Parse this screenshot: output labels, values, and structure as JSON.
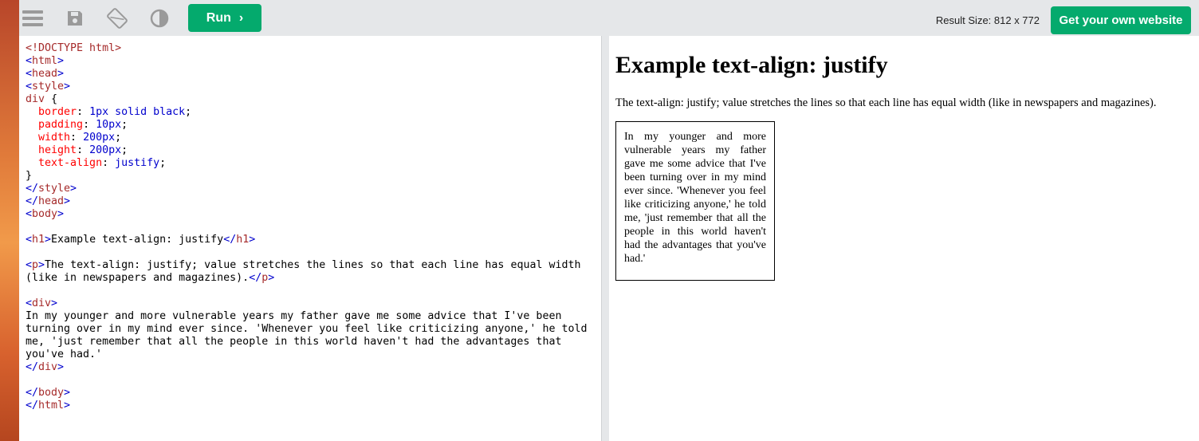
{
  "toolbar": {
    "menu_icon": "menu-icon",
    "save_icon": "save-icon",
    "rotate_icon": "rotate-icon",
    "theme_icon": "contrast-icon",
    "run_label": "Run",
    "result_size": "Result Size: 812 x 772",
    "get_site_label": "Get your own website"
  },
  "editor": {
    "lines": [
      [
        [
          "tag",
          "<!DOCTYPE html>"
        ]
      ],
      [
        [
          "br",
          "<"
        ],
        [
          "tag",
          "html"
        ],
        [
          "br",
          ">"
        ]
      ],
      [
        [
          "br",
          "<"
        ],
        [
          "tag",
          "head"
        ],
        [
          "br",
          ">"
        ]
      ],
      [
        [
          "br",
          "<"
        ],
        [
          "tag",
          "style"
        ],
        [
          "br",
          ">"
        ]
      ],
      [
        [
          "sel",
          "div "
        ],
        [
          "txt",
          "{"
        ]
      ],
      [
        [
          "txt",
          "  "
        ],
        [
          "prop",
          "border"
        ],
        [
          "txt",
          ": "
        ],
        [
          "val",
          "1px solid black"
        ],
        [
          "txt",
          ";"
        ]
      ],
      [
        [
          "txt",
          "  "
        ],
        [
          "prop",
          "padding"
        ],
        [
          "txt",
          ": "
        ],
        [
          "val",
          "10px"
        ],
        [
          "txt",
          ";"
        ]
      ],
      [
        [
          "txt",
          "  "
        ],
        [
          "prop",
          "width"
        ],
        [
          "txt",
          ": "
        ],
        [
          "val",
          "200px"
        ],
        [
          "txt",
          ";"
        ]
      ],
      [
        [
          "txt",
          "  "
        ],
        [
          "prop",
          "height"
        ],
        [
          "txt",
          ": "
        ],
        [
          "val",
          "200px"
        ],
        [
          "txt",
          ";"
        ]
      ],
      [
        [
          "txt",
          "  "
        ],
        [
          "prop",
          "text-align"
        ],
        [
          "txt",
          ": "
        ],
        [
          "val",
          "justify"
        ],
        [
          "txt",
          ";"
        ]
      ],
      [
        [
          "txt",
          "}"
        ]
      ],
      [
        [
          "br",
          "</"
        ],
        [
          "tag",
          "style"
        ],
        [
          "br",
          ">"
        ]
      ],
      [
        [
          "br",
          "</"
        ],
        [
          "tag",
          "head"
        ],
        [
          "br",
          ">"
        ]
      ],
      [
        [
          "br",
          "<"
        ],
        [
          "tag",
          "body"
        ],
        [
          "br",
          ">"
        ]
      ],
      [],
      [
        [
          "br",
          "<"
        ],
        [
          "tag",
          "h1"
        ],
        [
          "br",
          ">"
        ],
        [
          "txt",
          "Example text-align: justify"
        ],
        [
          "br",
          "</"
        ],
        [
          "tag",
          "h1"
        ],
        [
          "br",
          ">"
        ]
      ],
      [],
      [
        [
          "br",
          "<"
        ],
        [
          "tag",
          "p"
        ],
        [
          "br",
          ">"
        ],
        [
          "txt",
          "The text-align: justify; value stretches the lines so that each line has equal width"
        ]
      ],
      [
        [
          "txt",
          "(like in newspapers and magazines)."
        ],
        [
          "br",
          "</"
        ],
        [
          "tag",
          "p"
        ],
        [
          "br",
          ">"
        ]
      ],
      [],
      [
        [
          "br",
          "<"
        ],
        [
          "tag",
          "div"
        ],
        [
          "br",
          ">"
        ]
      ],
      [
        [
          "txt",
          "In my younger and more vulnerable years my father gave me some advice that I've been"
        ]
      ],
      [
        [
          "txt",
          "turning over in my mind ever since. 'Whenever you feel like criticizing anyone,' he told"
        ]
      ],
      [
        [
          "txt",
          "me, 'just remember that all the people in this world haven't had the advantages that"
        ]
      ],
      [
        [
          "txt",
          "you've had.'"
        ]
      ],
      [
        [
          "br",
          "</"
        ],
        [
          "tag",
          "div"
        ],
        [
          "br",
          ">"
        ]
      ],
      [],
      [
        [
          "br",
          "</"
        ],
        [
          "tag",
          "body"
        ],
        [
          "br",
          ">"
        ]
      ],
      [
        [
          "br",
          "</"
        ],
        [
          "tag",
          "html"
        ],
        [
          "br",
          ">"
        ]
      ]
    ]
  },
  "result": {
    "heading": "Example text-align: justify",
    "paragraph": "The text-align: justify; value stretches the lines so that each line has equal width (like in newspapers and magazines).",
    "box_text": "In my younger and more vulnerable years my father gave me some advice that I've been turning over in my mind ever since. 'Whenever you feel like criticizing anyone,' he told me, 'just remember that all the people in this world haven't had the advantages that you've had.'"
  }
}
